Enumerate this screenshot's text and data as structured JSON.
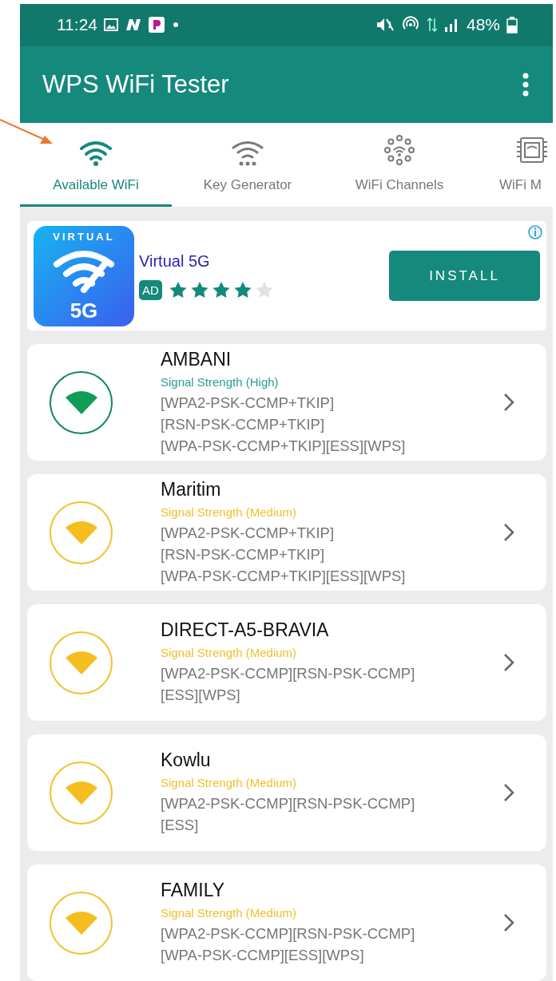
{
  "status_bar": {
    "time": "11:24",
    "battery": "48%"
  },
  "app_bar": {
    "title": "WPS WiFi Tester"
  },
  "tabs": [
    {
      "label": "Available WiFi",
      "kind": "wifi",
      "selected": true
    },
    {
      "label": "Key Generator",
      "kind": "keys",
      "selected": false
    },
    {
      "label": "WiFi Channels",
      "kind": "channels",
      "selected": false
    },
    {
      "label": "WiFi M",
      "kind": "chip",
      "selected": false
    }
  ],
  "ad": {
    "logo_top": "VIRTUAL",
    "logo_bottom": "5G",
    "title": "Virtual 5G",
    "badge": "AD",
    "stars": 4,
    "button": "INSTALL"
  },
  "networks": [
    {
      "name": "AMBANI",
      "kind": "high",
      "signal": "Signal Strength (High)",
      "capabilities": [
        "[WPA2-PSK-CCMP+TKIP]",
        "[RSN-PSK-CCMP+TKIP]",
        "[WPA-PSK-CCMP+TKIP][ESS][WPS]"
      ]
    },
    {
      "name": "Maritim",
      "kind": "medium",
      "signal": "Signal Strength (Medium)",
      "capabilities": [
        "[WPA2-PSK-CCMP+TKIP]",
        "[RSN-PSK-CCMP+TKIP]",
        "[WPA-PSK-CCMP+TKIP][ESS][WPS]"
      ]
    },
    {
      "name": "DIRECT-A5-BRAVIA",
      "kind": "medium",
      "signal": "Signal Strength (Medium)",
      "capabilities": [
        "[WPA2-PSK-CCMP][RSN-PSK-CCMP]",
        "[ESS][WPS]"
      ]
    },
    {
      "name": "Kowlu",
      "kind": "medium",
      "signal": "Signal Strength (Medium)",
      "capabilities": [
        "[WPA2-PSK-CCMP][RSN-PSK-CCMP]",
        "[ESS]"
      ]
    },
    {
      "name": "FAMILY",
      "kind": "medium",
      "signal": "Signal Strength (Medium)",
      "capabilities": [
        "[WPA2-PSK-CCMP][RSN-PSK-CCMP]",
        "[WPA-PSK-CCMP][ESS][WPS]"
      ]
    }
  ]
}
